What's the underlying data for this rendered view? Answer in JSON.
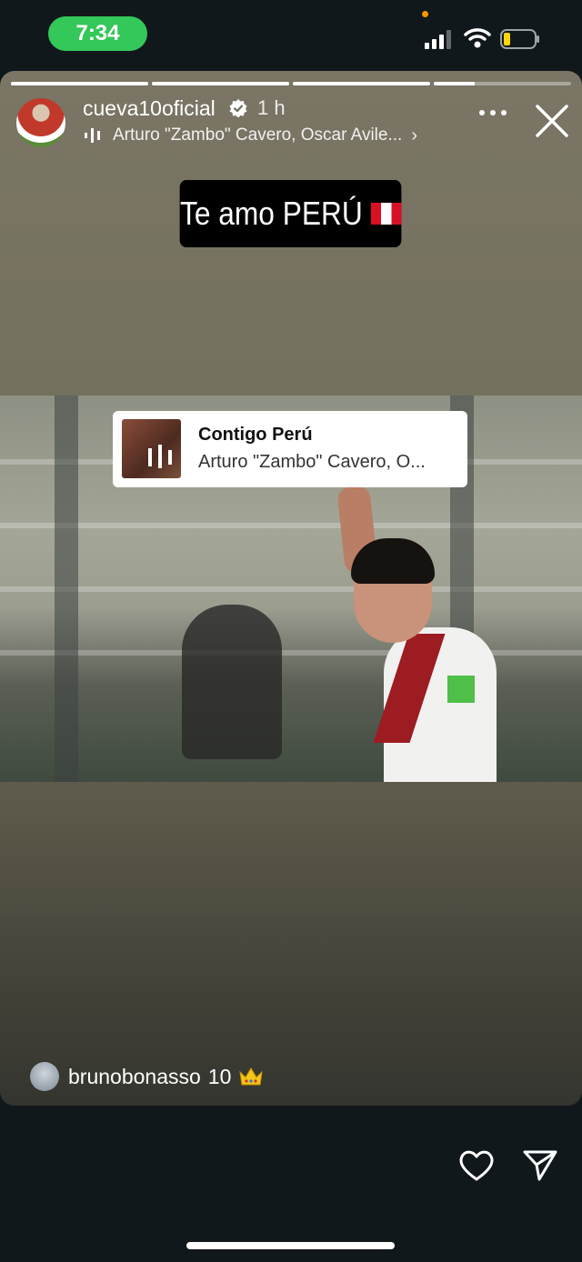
{
  "status_bar": {
    "time": "7:34"
  },
  "story": {
    "progress": [
      1,
      1,
      1,
      0.3
    ],
    "username": "cueva10oficial",
    "time_ago": "1 h",
    "music_line": "Arturo \"Zambo\" Cavero, Oscar Avile...",
    "caption": "Te amo PERÚ",
    "sticker": {
      "title": "Contigo Perú",
      "artist": "Arturo \"Zambo\" Cavero, O..."
    },
    "reply": {
      "username": "brunobonasso",
      "text": "10"
    }
  },
  "icons": {
    "more": "more-icon",
    "close": "close-icon",
    "heart": "heart-icon",
    "send": "send-icon"
  }
}
